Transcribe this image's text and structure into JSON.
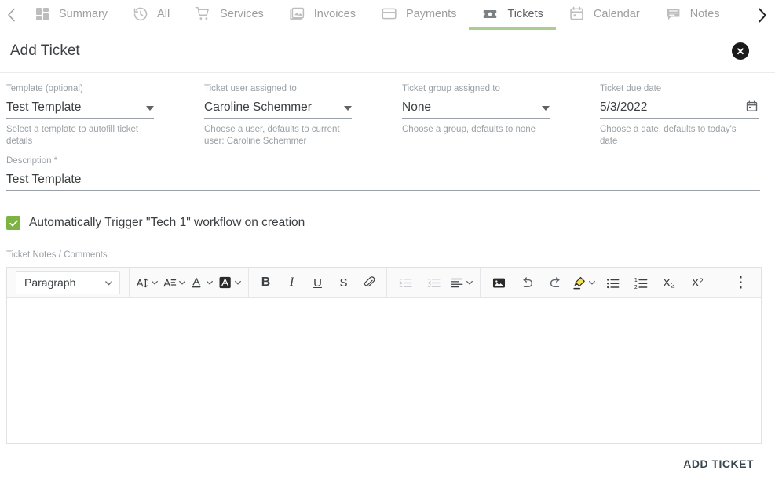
{
  "nav": {
    "scroll_left_icon": "chevron-left-icon",
    "scroll_right_icon": "chevron-right-icon",
    "active_underline_color": "#a8cf8f",
    "tabs": [
      {
        "label": "Summary",
        "icon": "dashboard-grid-icon",
        "active": false
      },
      {
        "label": "All",
        "icon": "history-clock-icon",
        "active": false
      },
      {
        "label": "Services",
        "icon": "shopping-cart-icon",
        "active": false
      },
      {
        "label": "Invoices",
        "icon": "image-gallery-icon",
        "active": false
      },
      {
        "label": "Payments",
        "icon": "credit-card-icon",
        "active": false
      },
      {
        "label": "Tickets",
        "icon": "ticket-star-icon",
        "active": true
      },
      {
        "label": "Calendar",
        "icon": "calendar-icon",
        "active": false
      },
      {
        "label": "Notes",
        "icon": "note-comment-icon",
        "active": false
      }
    ]
  },
  "header": {
    "title": "Add Ticket",
    "close_icon": "close-circle-icon",
    "close_glyph": "✕"
  },
  "form": {
    "template": {
      "label": "Template (optional)",
      "value": "Test Template",
      "hint": "Select a template to autofill ticket details",
      "caret_icon": "caret-down-icon"
    },
    "ticket_user": {
      "label": "Ticket user assigned to",
      "value": "Caroline Schemmer",
      "hint": "Choose a user, defaults to current user: Caroline Schemmer",
      "caret_icon": "caret-down-icon"
    },
    "ticket_group": {
      "label": "Ticket group assigned to",
      "value": "None",
      "hint": "Choose a group, defaults to none",
      "caret_icon": "caret-down-icon"
    },
    "due_date": {
      "label": "Ticket due date",
      "value": "5/3/2022",
      "hint": "Choose a date, defaults to today's date",
      "icon": "calendar-picker-icon"
    },
    "description": {
      "label": "Description *",
      "value": "Test Template"
    },
    "workflow_checkbox": {
      "label": "Automatically Trigger \"Tech 1\" workflow on creation",
      "checked": true,
      "color": "#7cb342",
      "check_glyph": "✔"
    }
  },
  "notes": {
    "label": "Ticket Notes / Comments",
    "body_value": "",
    "toolbar": {
      "paragraph_style": "Paragraph",
      "buttons": [
        {
          "name": "font-size-icon",
          "label": "A↕"
        },
        {
          "name": "line-height-icon",
          "label": "A≡"
        },
        {
          "name": "text-color-icon",
          "label": "A"
        },
        {
          "name": "background-color-icon",
          "label": "A"
        },
        {
          "name": "bold-icon",
          "label": "B"
        },
        {
          "name": "italic-icon",
          "label": "I"
        },
        {
          "name": "underline-icon",
          "label": "U"
        },
        {
          "name": "strikethrough-icon",
          "label": "S"
        },
        {
          "name": "link-icon",
          "label": "🔗"
        },
        {
          "name": "indent-increase-icon",
          "label": ""
        },
        {
          "name": "indent-decrease-icon",
          "label": ""
        },
        {
          "name": "align-left-icon",
          "label": ""
        },
        {
          "name": "insert-image-icon",
          "label": ""
        },
        {
          "name": "undo-icon",
          "label": ""
        },
        {
          "name": "redo-icon",
          "label": ""
        },
        {
          "name": "highlighter-icon",
          "label": ""
        },
        {
          "name": "bullet-list-icon",
          "label": ""
        },
        {
          "name": "numbered-list-icon",
          "label": ""
        },
        {
          "name": "subscript-icon",
          "label": "X₂"
        },
        {
          "name": "superscript-icon",
          "label": "X²"
        },
        {
          "name": "more-options-icon",
          "label": "⋮"
        }
      ]
    }
  },
  "footer": {
    "submit_label": "ADD TICKET"
  }
}
